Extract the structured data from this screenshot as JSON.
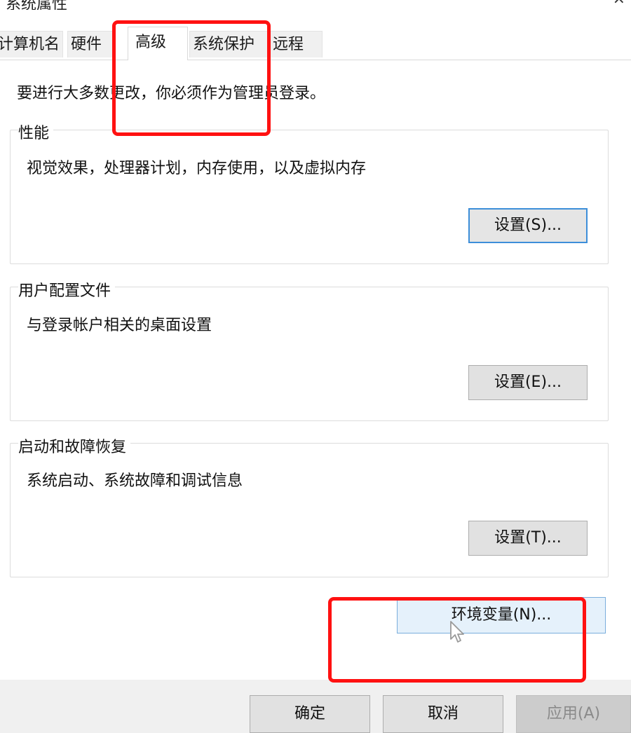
{
  "window": {
    "title": "系统属性",
    "close_glyph": "×"
  },
  "tabs": [
    {
      "label": "计算机名",
      "active": false
    },
    {
      "label": "硬件",
      "active": false
    },
    {
      "label": "高级",
      "active": true
    },
    {
      "label": "系统保护",
      "active": false
    },
    {
      "label": "远程",
      "active": false
    }
  ],
  "admin_notice": "要进行大多数更改，你必须作为管理员登录。",
  "groups": [
    {
      "title": "性能",
      "description": "视觉效果，处理器计划，内存使用，以及虚拟内存",
      "button": "设置(S)..."
    },
    {
      "title": "用户配置文件",
      "description": "与登录帐户相关的桌面设置",
      "button": "设置(E)..."
    },
    {
      "title": "启动和故障恢复",
      "description": "系统启动、系统故障和调试信息",
      "button": "设置(T)..."
    }
  ],
  "env_button": "环境变量(N)...",
  "footer": {
    "ok": "确定",
    "cancel": "取消",
    "apply": "应用(A)"
  },
  "colors": {
    "annotation": "#ff1111",
    "focus_border": "#3c8ed9",
    "hover_bg": "#e5f1fb",
    "footer_bg": "#f0f0f0"
  },
  "icons": {
    "cursor": "mouse-pointer-icon"
  }
}
